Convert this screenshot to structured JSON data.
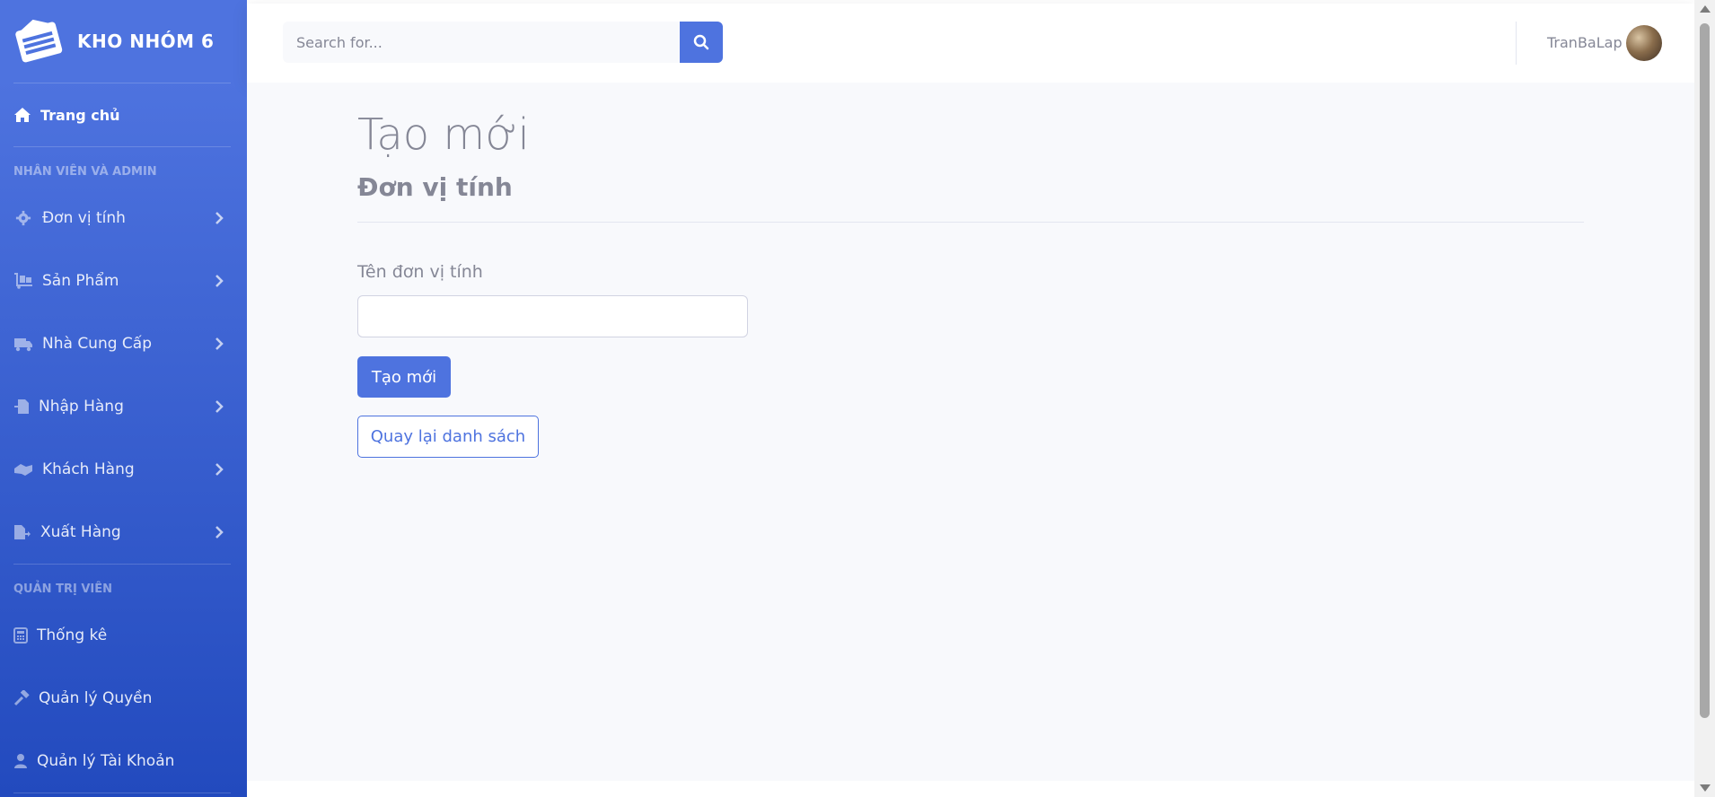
{
  "brand": {
    "name": "KHO NHÓM 6",
    "icon": "warehouse-icon"
  },
  "sidebar": {
    "home": {
      "label": "Trang chủ",
      "icon": "home-icon"
    },
    "section_staff": "NHÂN VIÊN VÀ ADMIN",
    "staff_items": [
      {
        "label": "Đơn vị tính",
        "icon": "gear-icon"
      },
      {
        "label": "Sản Phẩm",
        "icon": "dolly-icon"
      },
      {
        "label": "Nhà Cung Cấp",
        "icon": "truck-icon"
      },
      {
        "label": "Nhập Hàng",
        "icon": "file-import-icon"
      },
      {
        "label": "Khách Hàng",
        "icon": "handshake-icon"
      },
      {
        "label": "Xuất Hàng",
        "icon": "file-export-icon"
      }
    ],
    "section_admin": "QUẢN TRỊ VIÊN",
    "admin_items": [
      {
        "label": "Thống kê",
        "icon": "calculator-icon"
      },
      {
        "label": "Quản lý Quyền",
        "icon": "hammer-icon"
      },
      {
        "label": "Quản lý Tài Khoản",
        "icon": "user-icon"
      }
    ]
  },
  "topbar": {
    "search_placeholder": "Search for...",
    "user_name": "TranBaLap"
  },
  "main": {
    "title": "Tạo mới",
    "subtitle": "Đơn vị tính",
    "field_label": "Tên đơn vị tính",
    "field_value": "",
    "create_button": "Tạo mới",
    "back_button": "Quay lại danh sách"
  },
  "colors": {
    "primary": "#4e73df",
    "sidebar_gradient_end": "#224abe",
    "text_muted": "#858796",
    "background": "#f8f9fc"
  }
}
